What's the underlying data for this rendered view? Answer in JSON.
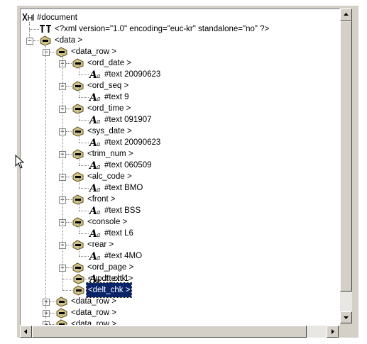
{
  "tree": {
    "document_label": "#document",
    "pi_label": "<?xml version=\"1.0\" encoding=\"euc-kr\" standalone=\"no\" ?>",
    "data_label": "<data >",
    "data_row_label": "<data_row >",
    "fields": [
      {
        "element": "<ord_date >",
        "text": "#text 20090623"
      },
      {
        "element": "<ord_seq >",
        "text": "#text 9"
      },
      {
        "element": "<ord_time >",
        "text": "#text 091907"
      },
      {
        "element": "<sys_date >",
        "text": "#text 20090623"
      },
      {
        "element": "<trim_num >",
        "text": "#text 060509"
      },
      {
        "element": "<alc_code >",
        "text": "#text BMO"
      },
      {
        "element": "<front >",
        "text": "#text BSS"
      },
      {
        "element": "<console >",
        "text": "#text L6"
      },
      {
        "element": "<rear >",
        "text": "#text 4MO"
      },
      {
        "element": "<ord_page >",
        "text": "#text 1"
      }
    ],
    "updt_chk_label": "<updt_chk >",
    "delt_chk_label": "<delt_chk >",
    "collapsed_rows": [
      "<data_row >",
      "<data_row >",
      "<data_row >",
      "<data_row >"
    ]
  },
  "icons": {
    "document": "xml-document-icon",
    "pi": "processing-instruction-icon",
    "element": "element-node-icon",
    "text": "text-node-icon"
  },
  "colors": {
    "selection": "#0a246a",
    "element_icon": "#cfc38a",
    "window_bg": "#d4d0c8"
  }
}
